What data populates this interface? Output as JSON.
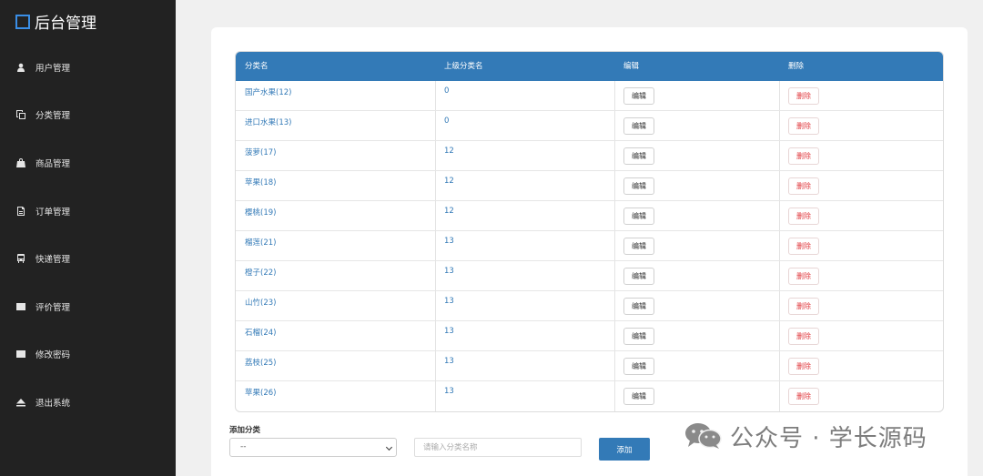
{
  "sidebar": {
    "brand": "后台管理",
    "items": [
      {
        "label": "用户管理",
        "icon": "user-icon"
      },
      {
        "label": "分类管理",
        "icon": "copy-icon"
      },
      {
        "label": "商品管理",
        "icon": "shopping-bag-icon"
      },
      {
        "label": "订单管理",
        "icon": "document-icon"
      },
      {
        "label": "快递管理",
        "icon": "bus-icon"
      },
      {
        "label": "评价管理",
        "icon": "inbox-icon"
      },
      {
        "label": "修改密码",
        "icon": "inbox-icon"
      },
      {
        "label": "退出系统",
        "icon": "eject-icon"
      }
    ]
  },
  "table": {
    "headers": [
      "分类名",
      "上级分类名",
      "编辑",
      "删除"
    ],
    "edit_label": "编辑",
    "delete_label": "删除",
    "rows": [
      {
        "name": "国产水果(12)",
        "parent": "0"
      },
      {
        "name": "进口水果(13)",
        "parent": "0"
      },
      {
        "name": "菠萝(17)",
        "parent": "12"
      },
      {
        "name": "苹果(18)",
        "parent": "12"
      },
      {
        "name": "樱桃(19)",
        "parent": "12"
      },
      {
        "name": "榴莲(21)",
        "parent": "13"
      },
      {
        "name": "橙子(22)",
        "parent": "13"
      },
      {
        "name": "山竹(23)",
        "parent": "13"
      },
      {
        "name": "石榴(24)",
        "parent": "13"
      },
      {
        "name": "荔枝(25)",
        "parent": "13"
      },
      {
        "name": "苹果(26)",
        "parent": "13"
      }
    ]
  },
  "add_form": {
    "title": "添加分类",
    "select_value": "--",
    "input_placeholder": "请输入分类名称",
    "submit_label": "添加"
  },
  "watermark": {
    "text": "公众号 · 学长源码"
  }
}
